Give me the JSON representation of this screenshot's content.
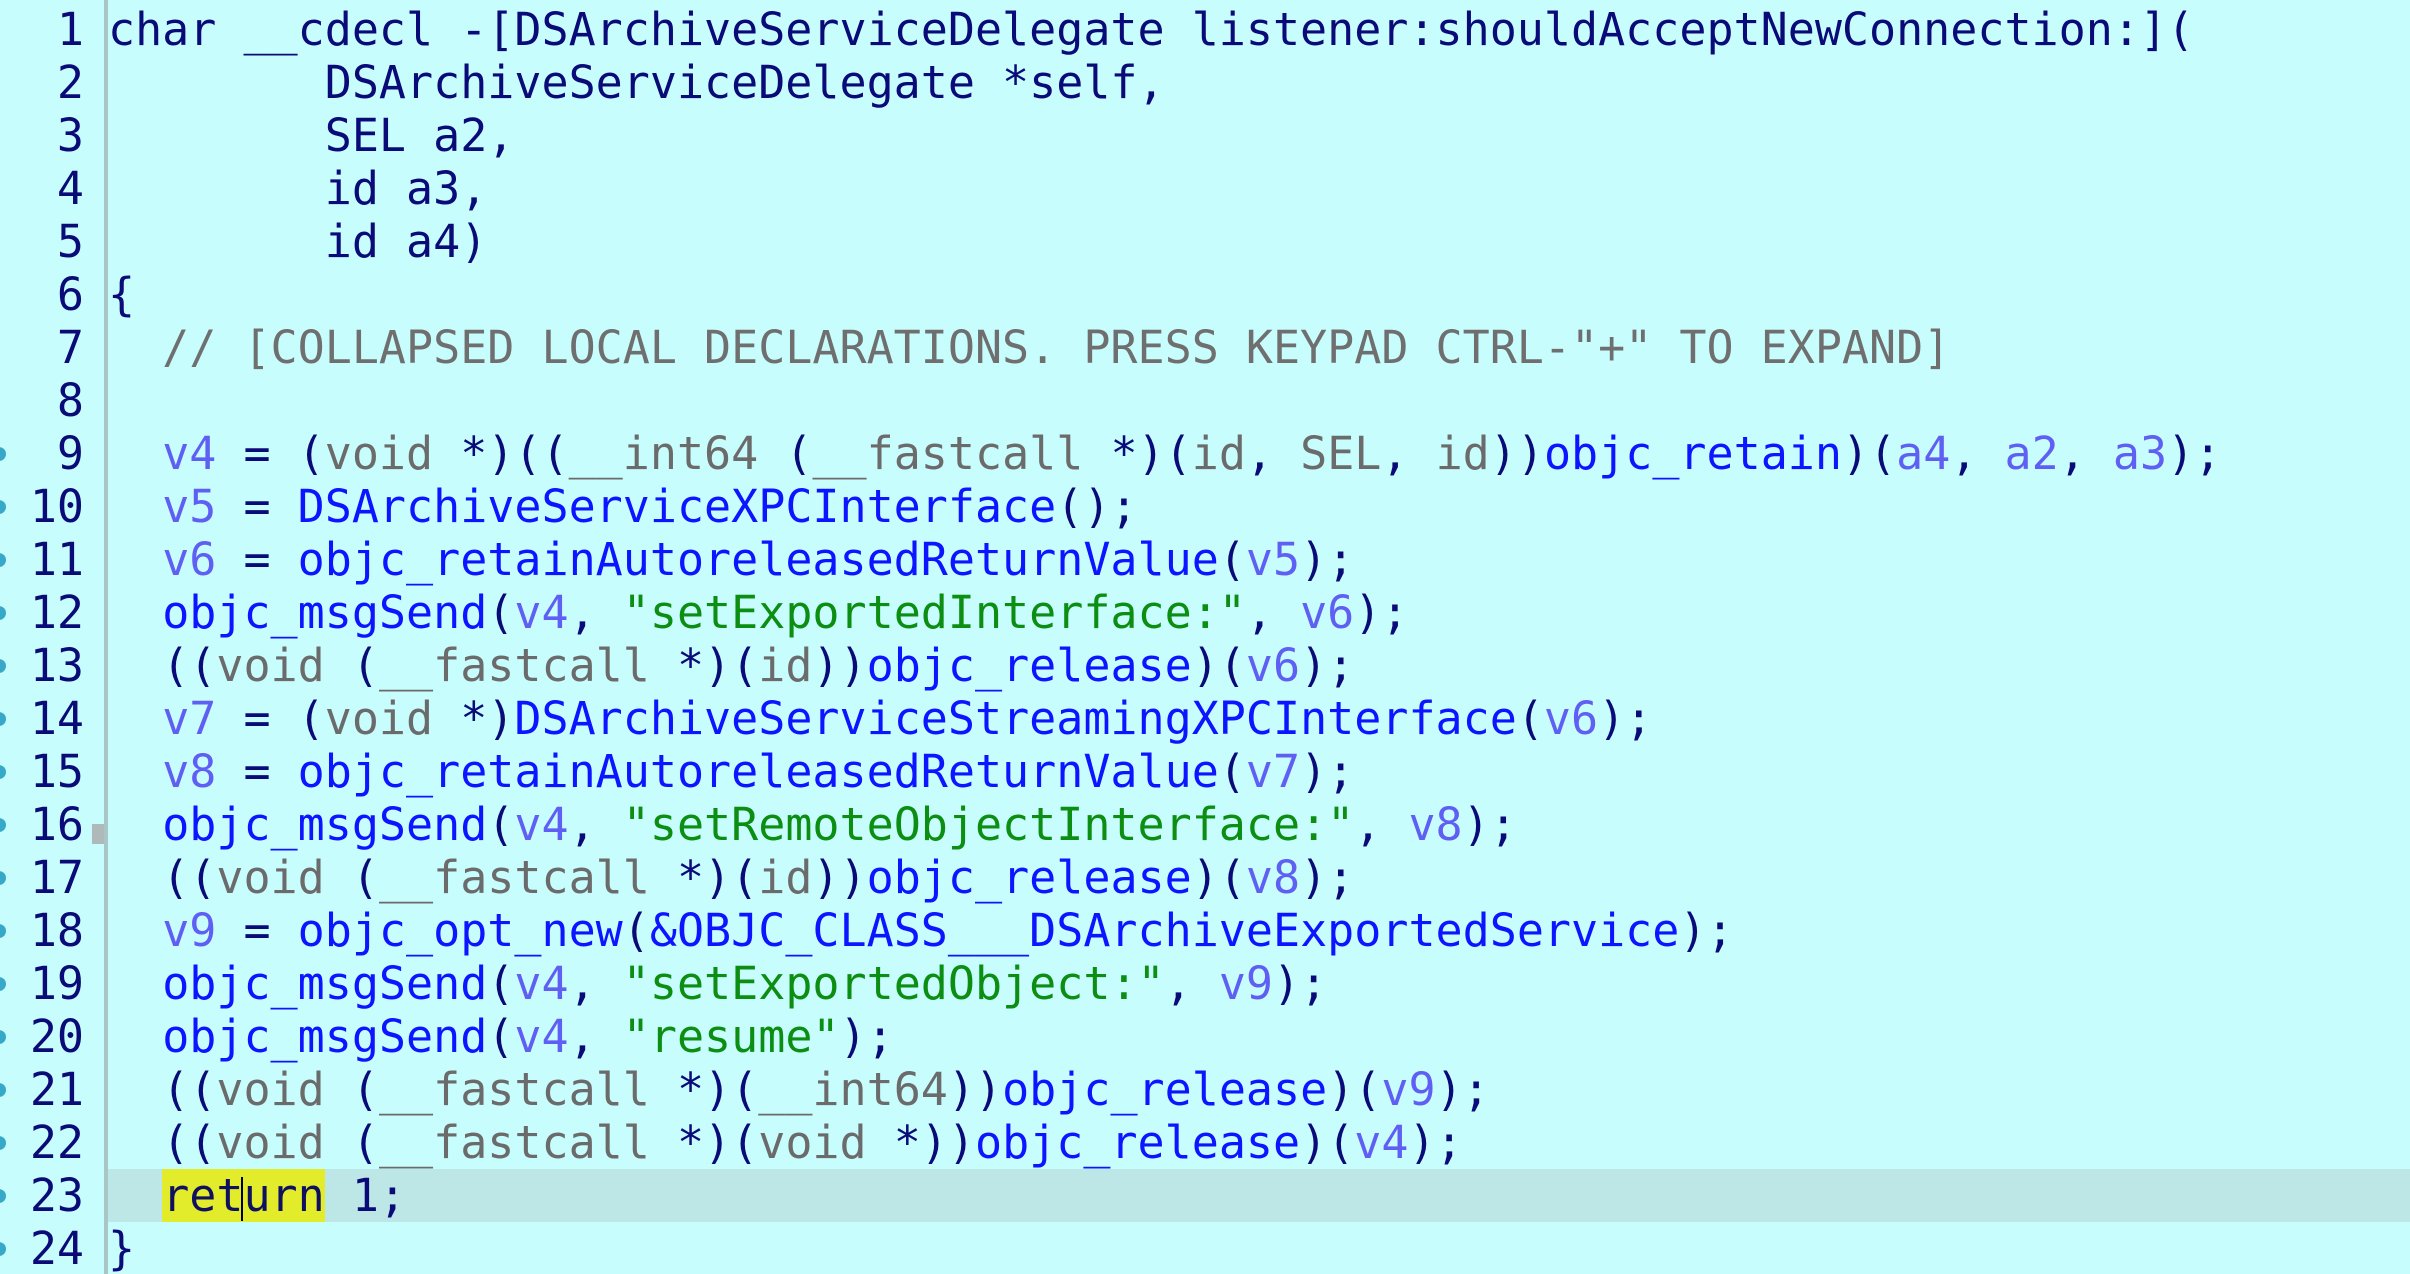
{
  "editor": {
    "lines": [
      {
        "num": "1",
        "segments": [
          {
            "c": "t-dark",
            "t": "char __cdecl -[DSArchiveServiceDelegate listener:shouldAcceptNewConnection:]("
          }
        ]
      },
      {
        "num": "2",
        "segments": [
          {
            "c": "t-dark",
            "t": "        DSArchiveServiceDelegate *self,"
          }
        ]
      },
      {
        "num": "3",
        "segments": [
          {
            "c": "t-dark",
            "t": "        SEL a2,"
          }
        ]
      },
      {
        "num": "4",
        "segments": [
          {
            "c": "t-dark",
            "t": "        id a3,"
          }
        ]
      },
      {
        "num": "5",
        "segments": [
          {
            "c": "t-dark",
            "t": "        id a4)"
          }
        ]
      },
      {
        "num": "6",
        "segments": [
          {
            "c": "t-dark",
            "t": "{"
          }
        ]
      },
      {
        "num": "7",
        "segments": [
          {
            "c": "t-cm",
            "t": "  // [COLLAPSED LOCAL DECLARATIONS. PRESS KEYPAD CTRL-\"+\" TO EXPAND]"
          }
        ]
      },
      {
        "num": "8",
        "segments": []
      },
      {
        "num": "9",
        "dot": true,
        "segments": [
          {
            "c": "t-dark",
            "t": "  "
          },
          {
            "c": "t-var",
            "t": "v4"
          },
          {
            "c": "t-dark",
            "t": " = ("
          },
          {
            "c": "t-type",
            "t": "void"
          },
          {
            "c": "t-dark",
            "t": " *)(("
          },
          {
            "c": "t-type",
            "t": "__int64"
          },
          {
            "c": "t-dark",
            "t": " ("
          },
          {
            "c": "t-type",
            "t": "__fastcall"
          },
          {
            "c": "t-dark",
            "t": " *)("
          },
          {
            "c": "t-type",
            "t": "id"
          },
          {
            "c": "t-dark",
            "t": ", "
          },
          {
            "c": "t-type",
            "t": "SEL"
          },
          {
            "c": "t-dark",
            "t": ", "
          },
          {
            "c": "t-type",
            "t": "id"
          },
          {
            "c": "t-dark",
            "t": "))"
          },
          {
            "c": "t-fn",
            "t": "objc_retain"
          },
          {
            "c": "t-dark",
            "t": ")("
          },
          {
            "c": "t-var",
            "t": "a4"
          },
          {
            "c": "t-dark",
            "t": ", "
          },
          {
            "c": "t-var",
            "t": "a2"
          },
          {
            "c": "t-dark",
            "t": ", "
          },
          {
            "c": "t-var",
            "t": "a3"
          },
          {
            "c": "t-dark",
            "t": ");"
          }
        ]
      },
      {
        "num": "10",
        "dot": true,
        "segments": [
          {
            "c": "t-dark",
            "t": "  "
          },
          {
            "c": "t-var",
            "t": "v5"
          },
          {
            "c": "t-dark",
            "t": " = "
          },
          {
            "c": "t-fn",
            "t": "DSArchiveServiceXPCInterface"
          },
          {
            "c": "t-dark",
            "t": "();"
          }
        ]
      },
      {
        "num": "11",
        "dot": true,
        "segments": [
          {
            "c": "t-dark",
            "t": "  "
          },
          {
            "c": "t-var",
            "t": "v6"
          },
          {
            "c": "t-dark",
            "t": " = "
          },
          {
            "c": "t-fn",
            "t": "objc_retainAutoreleasedReturnValue"
          },
          {
            "c": "t-dark",
            "t": "("
          },
          {
            "c": "t-var",
            "t": "v5"
          },
          {
            "c": "t-dark",
            "t": ");"
          }
        ]
      },
      {
        "num": "12",
        "dot": true,
        "segments": [
          {
            "c": "t-dark",
            "t": "  "
          },
          {
            "c": "t-fn",
            "t": "objc_msgSend"
          },
          {
            "c": "t-dark",
            "t": "("
          },
          {
            "c": "t-var",
            "t": "v4"
          },
          {
            "c": "t-dark",
            "t": ", "
          },
          {
            "c": "t-str",
            "t": "\"setExportedInterface:\""
          },
          {
            "c": "t-dark",
            "t": ", "
          },
          {
            "c": "t-var",
            "t": "v6"
          },
          {
            "c": "t-dark",
            "t": ");"
          }
        ]
      },
      {
        "num": "13",
        "dot": true,
        "segments": [
          {
            "c": "t-dark",
            "t": "  (("
          },
          {
            "c": "t-type",
            "t": "void"
          },
          {
            "c": "t-dark",
            "t": " ("
          },
          {
            "c": "t-type",
            "t": "__fastcall"
          },
          {
            "c": "t-dark",
            "t": " *)("
          },
          {
            "c": "t-type",
            "t": "id"
          },
          {
            "c": "t-dark",
            "t": "))"
          },
          {
            "c": "t-fn",
            "t": "objc_release"
          },
          {
            "c": "t-dark",
            "t": ")("
          },
          {
            "c": "t-var",
            "t": "v6"
          },
          {
            "c": "t-dark",
            "t": ");"
          }
        ]
      },
      {
        "num": "14",
        "dot": true,
        "segments": [
          {
            "c": "t-dark",
            "t": "  "
          },
          {
            "c": "t-var",
            "t": "v7"
          },
          {
            "c": "t-dark",
            "t": " = ("
          },
          {
            "c": "t-type",
            "t": "void"
          },
          {
            "c": "t-dark",
            "t": " *)"
          },
          {
            "c": "t-fn",
            "t": "DSArchiveServiceStreamingXPCInterface"
          },
          {
            "c": "t-dark",
            "t": "("
          },
          {
            "c": "t-var",
            "t": "v6"
          },
          {
            "c": "t-dark",
            "t": ");"
          }
        ]
      },
      {
        "num": "15",
        "dot": true,
        "segments": [
          {
            "c": "t-dark",
            "t": "  "
          },
          {
            "c": "t-var",
            "t": "v8"
          },
          {
            "c": "t-dark",
            "t": " = "
          },
          {
            "c": "t-fn",
            "t": "objc_retainAutoreleasedReturnValue"
          },
          {
            "c": "t-dark",
            "t": "("
          },
          {
            "c": "t-var",
            "t": "v7"
          },
          {
            "c": "t-dark",
            "t": ");"
          }
        ]
      },
      {
        "num": "16",
        "dot": true,
        "mark": true,
        "segments": [
          {
            "c": "t-dark",
            "t": "  "
          },
          {
            "c": "t-fn",
            "t": "objc_msgSend"
          },
          {
            "c": "t-dark",
            "t": "("
          },
          {
            "c": "t-var",
            "t": "v4"
          },
          {
            "c": "t-dark",
            "t": ", "
          },
          {
            "c": "t-str",
            "t": "\"setRemoteObjectInterface:\""
          },
          {
            "c": "t-dark",
            "t": ", "
          },
          {
            "c": "t-var",
            "t": "v8"
          },
          {
            "c": "t-dark",
            "t": ");"
          }
        ]
      },
      {
        "num": "17",
        "dot": true,
        "segments": [
          {
            "c": "t-dark",
            "t": "  (("
          },
          {
            "c": "t-type",
            "t": "void"
          },
          {
            "c": "t-dark",
            "t": " ("
          },
          {
            "c": "t-type",
            "t": "__fastcall"
          },
          {
            "c": "t-dark",
            "t": " *)("
          },
          {
            "c": "t-type",
            "t": "id"
          },
          {
            "c": "t-dark",
            "t": "))"
          },
          {
            "c": "t-fn",
            "t": "objc_release"
          },
          {
            "c": "t-dark",
            "t": ")("
          },
          {
            "c": "t-var",
            "t": "v8"
          },
          {
            "c": "t-dark",
            "t": ");"
          }
        ]
      },
      {
        "num": "18",
        "dot": true,
        "segments": [
          {
            "c": "t-dark",
            "t": "  "
          },
          {
            "c": "t-var",
            "t": "v9"
          },
          {
            "c": "t-dark",
            "t": " = "
          },
          {
            "c": "t-fn",
            "t": "objc_opt_new"
          },
          {
            "c": "t-dark",
            "t": "("
          },
          {
            "c": "t-fn",
            "t": "&OBJC_CLASS___DSArchiveExportedService"
          },
          {
            "c": "t-dark",
            "t": ");"
          }
        ]
      },
      {
        "num": "19",
        "dot": true,
        "segments": [
          {
            "c": "t-dark",
            "t": "  "
          },
          {
            "c": "t-fn",
            "t": "objc_msgSend"
          },
          {
            "c": "t-dark",
            "t": "("
          },
          {
            "c": "t-var",
            "t": "v4"
          },
          {
            "c": "t-dark",
            "t": ", "
          },
          {
            "c": "t-str",
            "t": "\"setExportedObject:\""
          },
          {
            "c": "t-dark",
            "t": ", "
          },
          {
            "c": "t-var",
            "t": "v9"
          },
          {
            "c": "t-dark",
            "t": ");"
          }
        ]
      },
      {
        "num": "20",
        "dot": true,
        "segments": [
          {
            "c": "t-dark",
            "t": "  "
          },
          {
            "c": "t-fn",
            "t": "objc_msgSend"
          },
          {
            "c": "t-dark",
            "t": "("
          },
          {
            "c": "t-var",
            "t": "v4"
          },
          {
            "c": "t-dark",
            "t": ", "
          },
          {
            "c": "t-str",
            "t": "\"resume\""
          },
          {
            "c": "t-dark",
            "t": ");"
          }
        ]
      },
      {
        "num": "21",
        "dot": true,
        "segments": [
          {
            "c": "t-dark",
            "t": "  (("
          },
          {
            "c": "t-type",
            "t": "void"
          },
          {
            "c": "t-dark",
            "t": " ("
          },
          {
            "c": "t-type",
            "t": "__fastcall"
          },
          {
            "c": "t-dark",
            "t": " *)("
          },
          {
            "c": "t-type",
            "t": "__int64"
          },
          {
            "c": "t-dark",
            "t": "))"
          },
          {
            "c": "t-fn",
            "t": "objc_release"
          },
          {
            "c": "t-dark",
            "t": ")("
          },
          {
            "c": "t-var",
            "t": "v9"
          },
          {
            "c": "t-dark",
            "t": ");"
          }
        ]
      },
      {
        "num": "22",
        "dot": true,
        "segments": [
          {
            "c": "t-dark",
            "t": "  (("
          },
          {
            "c": "t-type",
            "t": "void"
          },
          {
            "c": "t-dark",
            "t": " ("
          },
          {
            "c": "t-type",
            "t": "__fastcall"
          },
          {
            "c": "t-dark",
            "t": " *)("
          },
          {
            "c": "t-type",
            "t": "void"
          },
          {
            "c": "t-dark",
            "t": " *))"
          },
          {
            "c": "t-fn",
            "t": "objc_release"
          },
          {
            "c": "t-dark",
            "t": ")("
          },
          {
            "c": "t-var",
            "t": "v4"
          },
          {
            "c": "t-dark",
            "t": ");"
          }
        ]
      },
      {
        "num": "23",
        "dot": true,
        "current": true,
        "segments": [
          {
            "c": "t-dark",
            "t": "  "
          },
          {
            "c": "t-hl",
            "t": "ret"
          },
          {
            "c": "cursor",
            "t": ""
          },
          {
            "c": "t-hl",
            "t": "urn"
          },
          {
            "c": "t-dark",
            "t": " 1;"
          }
        ]
      },
      {
        "num": "24",
        "dot": true,
        "segments": [
          {
            "c": "t-dark",
            "t": "}"
          }
        ]
      }
    ]
  },
  "colors": {
    "background": "#c8fdfd",
    "current_line": "#bde7e7",
    "keyword_highlight": "#e2ec2a",
    "function": "#0d14ff",
    "variable": "#5f5ff3",
    "string": "#0b8e11",
    "comment": "#6f6f6f"
  }
}
